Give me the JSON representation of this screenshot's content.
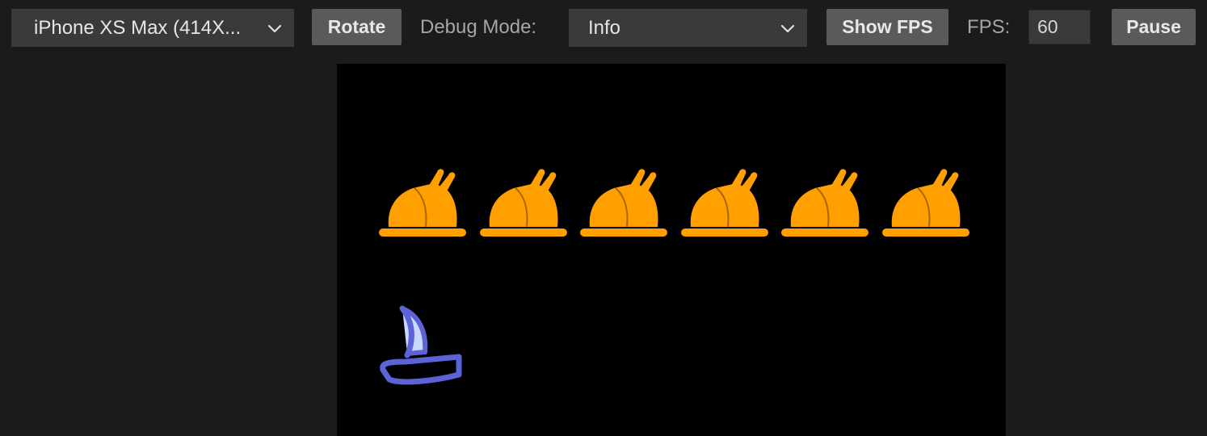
{
  "toolbar": {
    "device_select": {
      "value": "iPhone XS Max (414X..."
    },
    "rotate_label": "Rotate",
    "debug_mode_label": "Debug Mode:",
    "debug_mode_select": {
      "value": "Info"
    },
    "show_fps_label": "Show FPS",
    "fps_label": "FPS:",
    "fps_value": "60",
    "pause_label": "Pause"
  },
  "game": {
    "enemies": [
      {
        "icon": "roast-turkey-icon",
        "color": "#ff9f00"
      },
      {
        "icon": "roast-turkey-icon",
        "color": "#ff9f00"
      },
      {
        "icon": "roast-turkey-icon",
        "color": "#ff9f00"
      },
      {
        "icon": "roast-turkey-icon",
        "color": "#ff9f00"
      },
      {
        "icon": "roast-turkey-icon",
        "color": "#ff9f00"
      },
      {
        "icon": "roast-turkey-icon",
        "color": "#ff9f00"
      }
    ],
    "player": {
      "icon": "sailboat-icon",
      "color": "#5b63d6",
      "sail_color": "#c8d8ff"
    }
  }
}
